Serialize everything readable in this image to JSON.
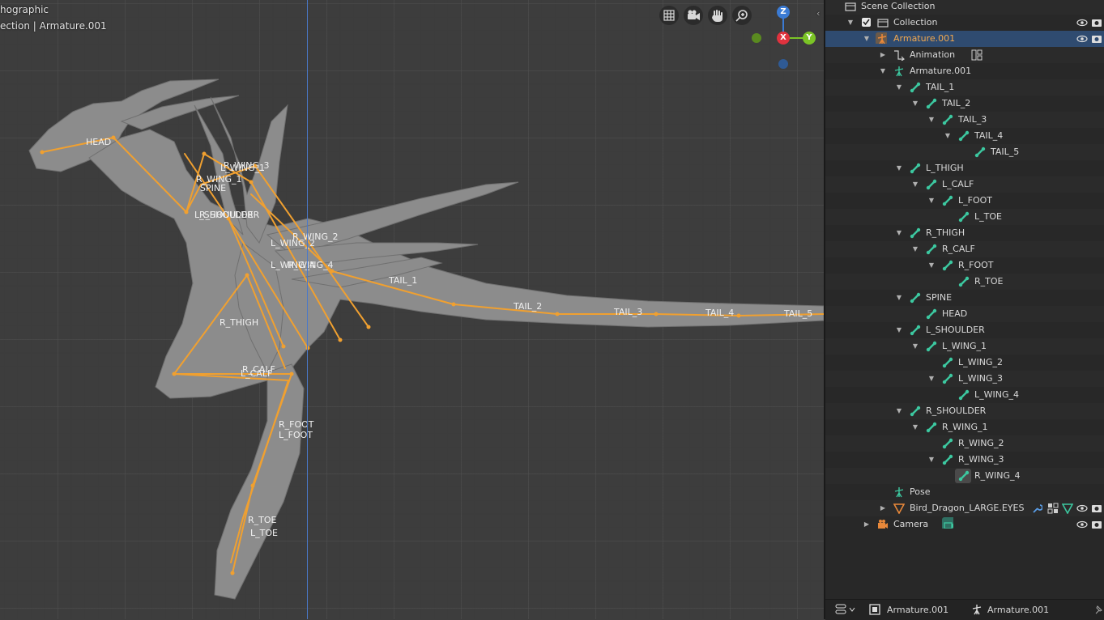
{
  "viewport": {
    "view_mode": "hographic",
    "collection_path": "ection | Armature.001",
    "gizmo": {
      "z": "Z",
      "x": "X",
      "y": "Y"
    },
    "nav_icons": [
      "grid-icon",
      "camera-icon",
      "hand-icon",
      "zoom-icon"
    ],
    "bone_labels": {
      "head": "HEAD",
      "wing3": "R_WING_3",
      "lwing1": "L_WING_1",
      "rwing1": "R_WING_1",
      "spine": "SPINE",
      "shoulder": "L_SHOULDER",
      "shoulder2": "R_SHOULDER",
      "rwing2": "R_WING_2",
      "lwing2": "L_WING_2",
      "lwing4": "L_WING_4",
      "rwing4": "R_WING_4",
      "tail1": "TAIL_1",
      "tail2": "TAIL_2",
      "tail3": "TAIL_3",
      "tail4": "TAIL_4",
      "tail5": "TAIL_5",
      "rthigh": "R_THIGH",
      "rcalf": "R_CALF",
      "lcalf": "L_CALF",
      "rfoot": "R_FOOT",
      "lfoot": "L_FOOT",
      "rtoe": "R_TOE",
      "ltoe": "L_TOE"
    }
  },
  "outliner": {
    "rows": [
      {
        "label": "Scene Collection"
      },
      {
        "label": "Collection"
      },
      {
        "label": "Armature.001"
      },
      {
        "label": "Animation"
      },
      {
        "label": "Armature.001"
      },
      {
        "label": "TAIL_1"
      },
      {
        "label": "TAIL_2"
      },
      {
        "label": "TAIL_3"
      },
      {
        "label": "TAIL_4"
      },
      {
        "label": "TAIL_5"
      },
      {
        "label": "L_THIGH"
      },
      {
        "label": "L_CALF"
      },
      {
        "label": "L_FOOT"
      },
      {
        "label": "L_TOE"
      },
      {
        "label": "R_THIGH"
      },
      {
        "label": "R_CALF"
      },
      {
        "label": "R_FOOT"
      },
      {
        "label": "R_TOE"
      },
      {
        "label": "SPINE"
      },
      {
        "label": "HEAD"
      },
      {
        "label": "L_SHOULDER"
      },
      {
        "label": "L_WING_1"
      },
      {
        "label": "L_WING_2"
      },
      {
        "label": "L_WING_3"
      },
      {
        "label": "L_WING_4"
      },
      {
        "label": "R_SHOULDER"
      },
      {
        "label": "R_WING_1"
      },
      {
        "label": "R_WING_2"
      },
      {
        "label": "R_WING_3"
      },
      {
        "label": "R_WING_4"
      },
      {
        "label": "Pose"
      },
      {
        "label": "Bird_Dragon_LARGE.EYES"
      },
      {
        "label": "Camera"
      }
    ]
  },
  "statusbar": {
    "object": "Armature.001",
    "data": "Armature.001"
  },
  "colors": {
    "bone": "#f0a030",
    "selected_row": "#2f4b70",
    "bone_icon": "#3cc8a0",
    "object_icon": "#e8883a"
  }
}
